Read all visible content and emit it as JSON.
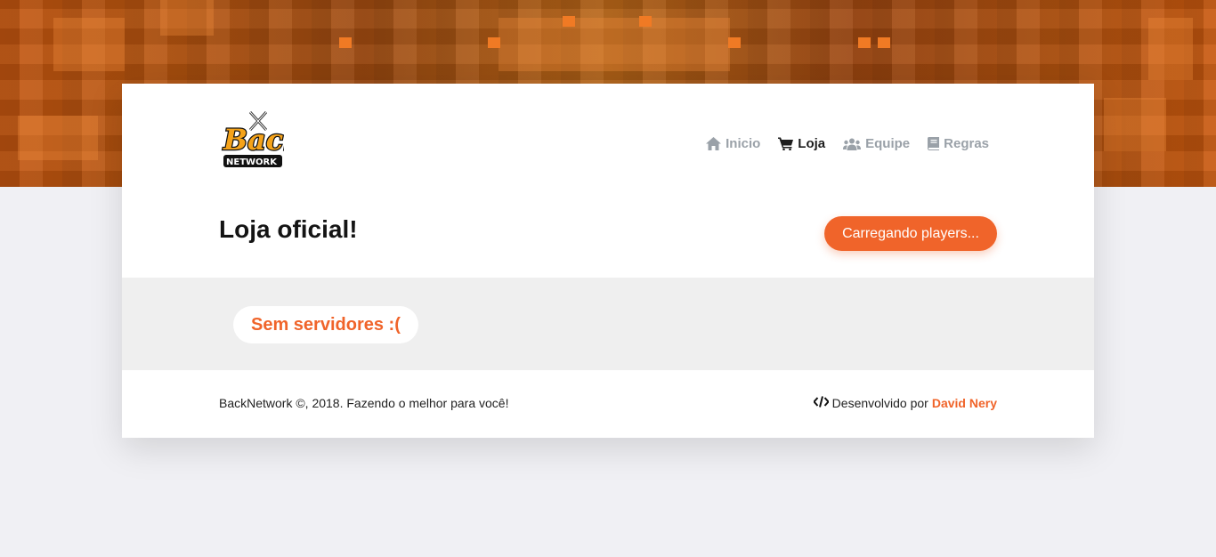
{
  "brand": {
    "logo_main_text": "Back",
    "logo_sub_text": "NETWORK"
  },
  "nav": {
    "items": [
      {
        "label": "Inicio",
        "icon": "home-icon"
      },
      {
        "label": "Loja",
        "icon": "cart-icon",
        "active": true
      },
      {
        "label": "Equipe",
        "icon": "users-icon"
      },
      {
        "label": "Regras",
        "icon": "book-icon"
      }
    ]
  },
  "page": {
    "title": "Loja oficial!",
    "players_button_label": "Carregando players..."
  },
  "servers": {
    "empty_message": "Sem servidores :("
  },
  "footer": {
    "copyright": "BackNetwork ©, 2018. Fazendo o melhor para você!",
    "dev_prefix": "Desenvolvido por",
    "dev_name": "David Nery",
    "dev_icon": "code-icon"
  },
  "colors": {
    "accent": "#f0642a",
    "hero": "#c2550f",
    "page_bg": "#f0f0f4"
  }
}
